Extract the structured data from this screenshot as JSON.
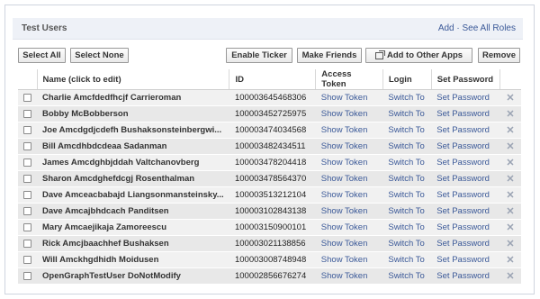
{
  "header": {
    "title": "Test Users",
    "add_link": "Add",
    "separator": " · ",
    "see_all_link": "See All Roles"
  },
  "toolbar": {
    "select_all": "Select All",
    "select_none": "Select None",
    "enable_ticker": "Enable Ticker",
    "make_friends": "Make Friends",
    "add_to_other_apps": "Add to Other Apps",
    "remove": "Remove"
  },
  "table": {
    "columns": [
      "Name (click to edit)",
      "ID",
      "Access Token",
      "Login",
      "Set Password"
    ],
    "rows": [
      {
        "name": "Charlie Amcfdedfhcjf Carrieroman",
        "id": "100003645468306",
        "token": "Show Token",
        "login": "Switch To",
        "password": "Set Password",
        "delete": "✕"
      },
      {
        "name": "Bobby McBobberson",
        "id": "100003452725975",
        "token": "Show Token",
        "login": "Switch To",
        "password": "Set Password",
        "delete": "✕"
      },
      {
        "name": "Joe Amcdgdjcdefh Bushaksonsteinbergwi...",
        "id": "100003474034568",
        "token": "Show Token",
        "login": "Switch To",
        "password": "Set Password",
        "delete": "✕"
      },
      {
        "name": "Bill Amcdhbdcdeaa Sadanman",
        "id": "100003482434511",
        "token": "Show Token",
        "login": "Switch To",
        "password": "Set Password",
        "delete": "✕"
      },
      {
        "name": "James Amcdghbjddah Valtchanovberg",
        "id": "100003478204418",
        "token": "Show Token",
        "login": "Switch To",
        "password": "Set Password",
        "delete": "✕"
      },
      {
        "name": "Sharon Amcdghefdcgj Rosenthalman",
        "id": "100003478564370",
        "token": "Show Token",
        "login": "Switch To",
        "password": "Set Password",
        "delete": "✕"
      },
      {
        "name": "Dave Amceacbabajd Liangsonmansteinsky...",
        "id": "100003513212104",
        "token": "Show Token",
        "login": "Switch To",
        "password": "Set Password",
        "delete": "✕"
      },
      {
        "name": "Dave Amcajbhdcach Panditsen",
        "id": "100003102843138",
        "token": "Show Token",
        "login": "Switch To",
        "password": "Set Password",
        "delete": "✕"
      },
      {
        "name": "Mary Amcaejikaja Zamoreescu",
        "id": "100003150900101",
        "token": "Show Token",
        "login": "Switch To",
        "password": "Set Password",
        "delete": "✕"
      },
      {
        "name": "Rick Amcjbaachhef Bushaksen",
        "id": "100003021138856",
        "token": "Show Token",
        "login": "Switch To",
        "password": "Set Password",
        "delete": "✕"
      },
      {
        "name": "Will Amckhgdhidh Moidusen",
        "id": "100003008748948",
        "token": "Show Token",
        "login": "Switch To",
        "password": "Set Password",
        "delete": "✕"
      },
      {
        "name": "OpenGraphTestUser DoNotModify",
        "id": "100002856676274",
        "token": "Show Token",
        "login": "Switch To",
        "password": "Set Password",
        "delete": "✕"
      }
    ]
  },
  "icons": {
    "add_to_apps": "share-box-icon",
    "delete": "close-icon",
    "checkbox": "checkbox-icon"
  },
  "colors": {
    "link": "#3b5998",
    "header_bg": "#eef1f7",
    "row_odd": "#f1f1f1",
    "row_even": "#e8e8e8"
  }
}
